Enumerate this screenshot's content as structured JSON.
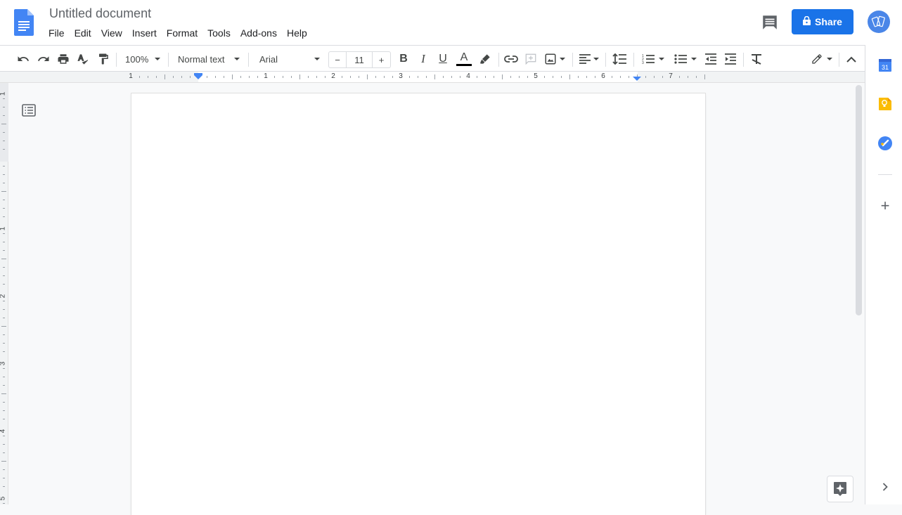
{
  "header": {
    "title": "Untitled document",
    "menu": [
      "File",
      "Edit",
      "View",
      "Insert",
      "Format",
      "Tools",
      "Add-ons",
      "Help"
    ],
    "share_label": "Share",
    "icons": {
      "logo": "google-docs-logo",
      "comments": "comments-icon",
      "share_lock": "lock-icon",
      "avatar": "account-avatar"
    }
  },
  "toolbar": {
    "zoom": "100%",
    "style": "Normal text",
    "font": "Arial",
    "font_size": "11",
    "decrease_label": "−",
    "increase_label": "+",
    "bold_label": "B",
    "italic_label": "I",
    "underline_label": "U",
    "text_color_label": "A",
    "text_color": "#000000",
    "tools": [
      "undo",
      "redo",
      "print",
      "spell-check",
      "paint-format",
      "zoom",
      "styles",
      "font",
      "font-size",
      "bold",
      "italic",
      "underline",
      "text-color",
      "highlight",
      "link",
      "comment",
      "image",
      "align",
      "line-spacing",
      "numbered-list",
      "bulleted-list",
      "decrease-indent",
      "increase-indent",
      "clear-formatting",
      "editing-mode",
      "hide-menus"
    ]
  },
  "ruler": {
    "horizontal_labels": [
      "1",
      "1",
      "2",
      "3",
      "4",
      "5",
      "6",
      "7"
    ],
    "vertical_labels": [
      "1",
      "1",
      "2",
      "3",
      "4",
      "5"
    ]
  },
  "side_panel": {
    "apps": [
      "calendar",
      "keep",
      "tasks"
    ],
    "calendar_day": "31",
    "add_label": "+"
  },
  "colors": {
    "accent": "#1a73e8",
    "docs_blue": "#4285f4",
    "keep_yellow": "#fbbc04"
  }
}
